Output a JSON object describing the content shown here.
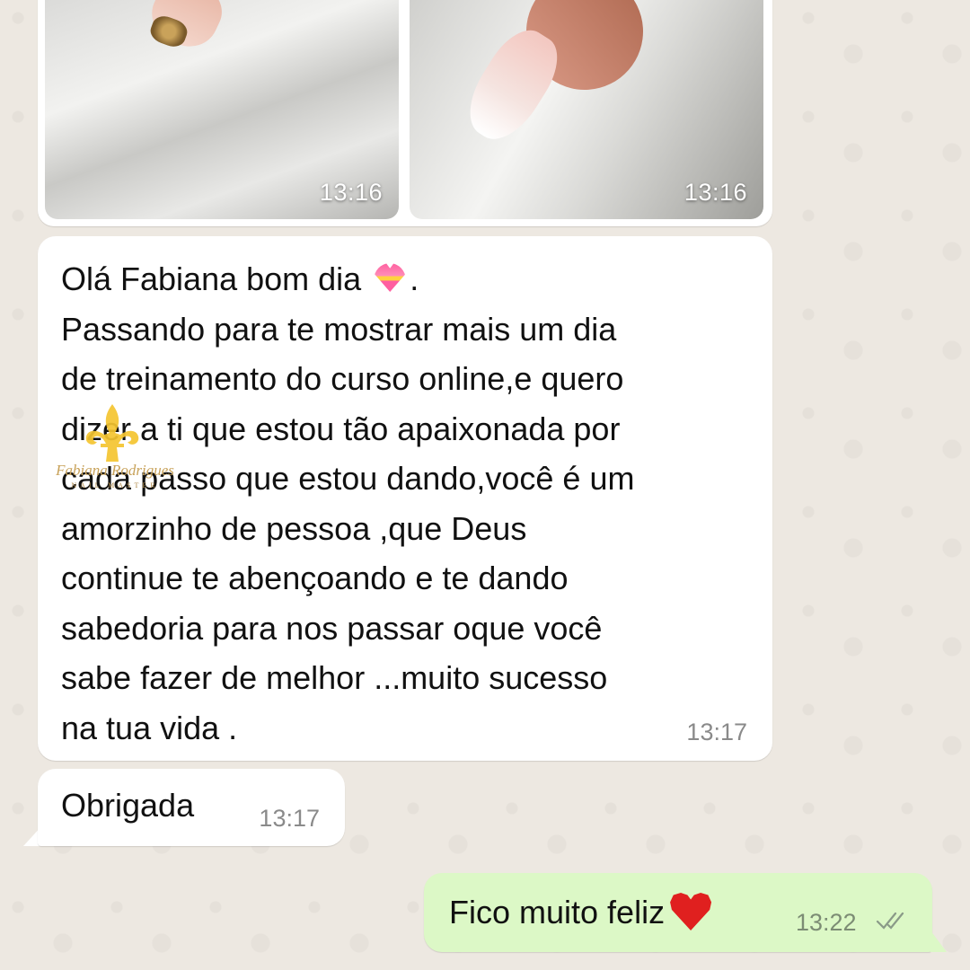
{
  "chat": {
    "image_message": {
      "photos": [
        {
          "time": "13:16"
        },
        {
          "time": "13:16"
        }
      ]
    },
    "messages": [
      {
        "direction": "incoming",
        "text_before_emoji": "Olá Fabiana bom dia ",
        "emoji": "heart-with-ribbon",
        "text_after_emoji": ".\nPassando para te mostrar mais um dia\nde treinamento do curso online,e quero\ndizer a ti que estou tão apaixonada por\ncada passo que estou dando,você é um\namorzinho de pessoa ,que Deus\ncontinue te abençoando e te dando\nsabedoria para nos passar oque você\nsabe fazer de melhor ...muito sucesso\nna tua vida .",
        "time": "13:17"
      },
      {
        "direction": "incoming",
        "text": "Obrigada",
        "time": "13:17"
      },
      {
        "direction": "outgoing",
        "text": "Fico muito feliz",
        "emoji": "red-heart",
        "time": "13:22",
        "status": "read"
      }
    ]
  },
  "watermark": {
    "name": "Fabiana Rodrigues",
    "subtitle": "NAIL MASTER"
  },
  "colors": {
    "incoming_bubble": "#ffffff",
    "outgoing_bubble": "#dcf8c6",
    "background": "#ede8e1",
    "watermark_gold": "#c8a25a"
  }
}
